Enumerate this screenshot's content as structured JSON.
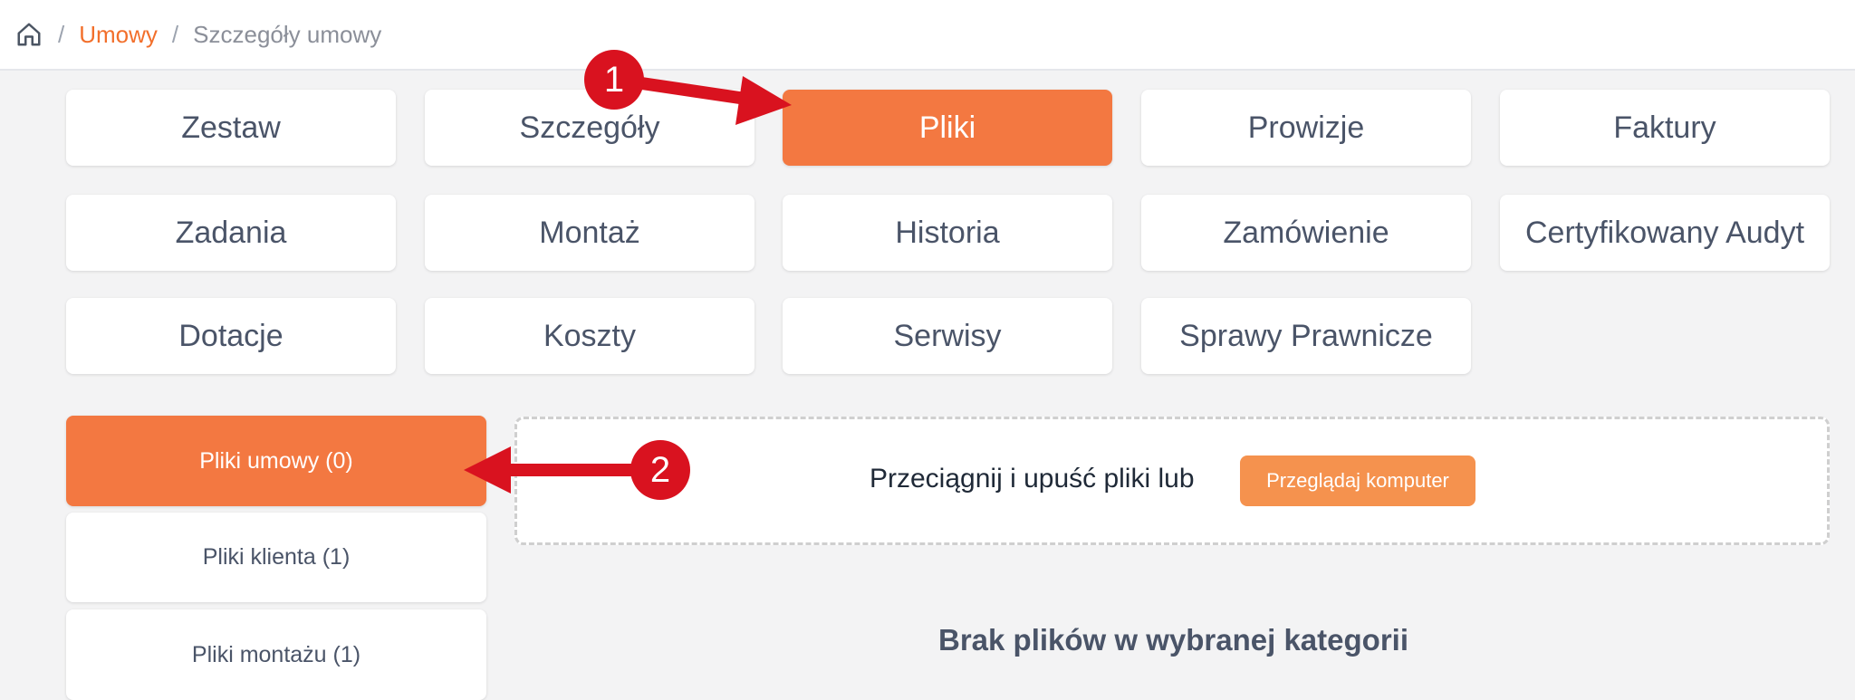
{
  "breadcrumb": {
    "home_icon": "home-icon",
    "items": [
      "Umowy",
      "Szczegóły umowy"
    ],
    "separator": "/"
  },
  "tabs": [
    {
      "label": "Zestaw",
      "active": false
    },
    {
      "label": "Szczegóły",
      "active": false
    },
    {
      "label": "Pliki",
      "active": true
    },
    {
      "label": "Prowizje",
      "active": false
    },
    {
      "label": "Faktury",
      "active": false
    },
    {
      "label": "Zadania",
      "active": false
    },
    {
      "label": "Montaż",
      "active": false
    },
    {
      "label": "Historia",
      "active": false
    },
    {
      "label": "Zamówienie",
      "active": false
    },
    {
      "label": "Certyfikowany Audyt",
      "active": false
    },
    {
      "label": "Dotacje",
      "active": false
    },
    {
      "label": "Koszty",
      "active": false
    },
    {
      "label": "Serwisy",
      "active": false
    },
    {
      "label": "Sprawy Prawnicze",
      "active": false
    }
  ],
  "file_categories": [
    {
      "label": "Pliki umowy (0)",
      "active": true
    },
    {
      "label": "Pliki klienta (1)",
      "active": false
    },
    {
      "label": "Pliki montażu (1)",
      "active": false
    }
  ],
  "upload": {
    "text": "Przeciągnij i upuść pliki lub",
    "browse_label": "Przeglądaj komputer"
  },
  "empty_message": "Brak plików w wybranej kategorii",
  "annotations": [
    {
      "number": "1"
    },
    {
      "number": "2"
    }
  ],
  "colors": {
    "accent": "#f37841",
    "link": "#f26f2b",
    "annotation": "#d9121f"
  }
}
